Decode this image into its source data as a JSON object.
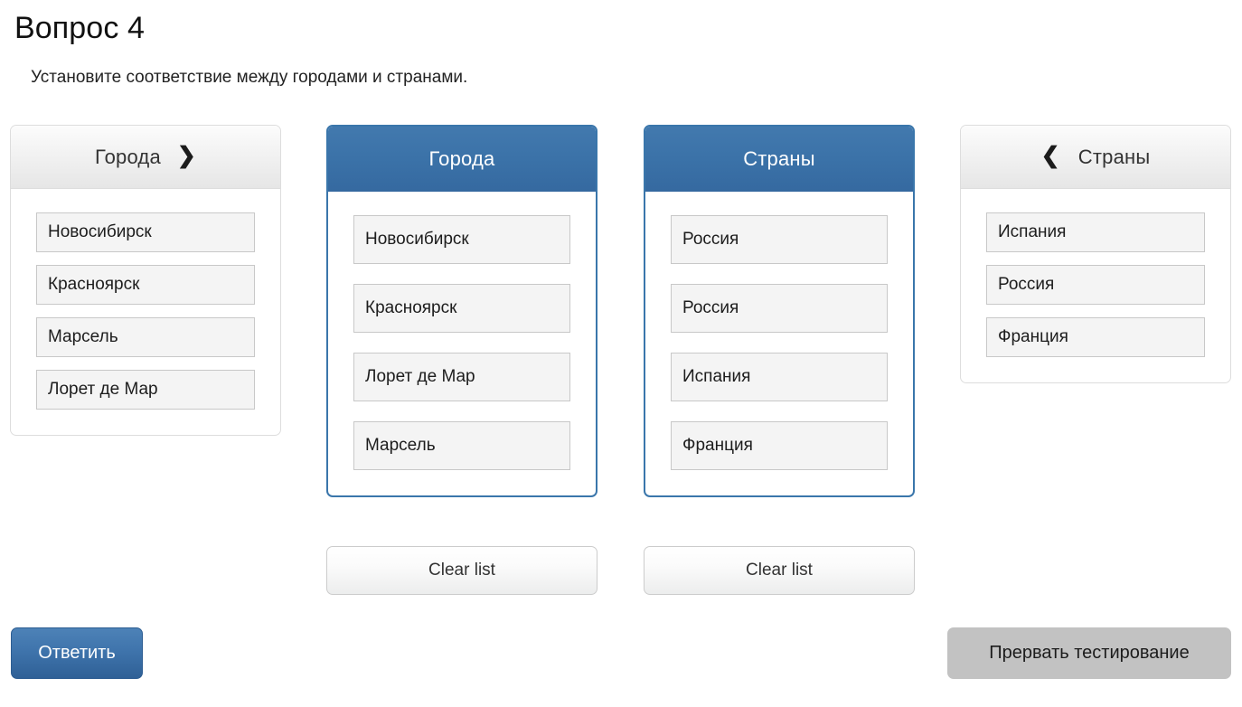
{
  "question": {
    "title": "Вопрос 4",
    "instruction": "Установите соответствие между городами и странами."
  },
  "colors": {
    "accent_blue": "#3a76ab",
    "button_blue": "#3f74ac",
    "abort_gray": "#c2c2c2",
    "item_fill": "#f4f4f4",
    "item_border": "#c8c8c8"
  },
  "panels": {
    "source_cities": {
      "header": "Города",
      "icon": "chevron-right-icon",
      "selected": false,
      "items": [
        "Новосибирск",
        "Красноярск",
        "Марсель",
        "Лорет де Мар"
      ]
    },
    "answer_cities": {
      "header": "Города",
      "selected": true,
      "items": [
        "Новосибирск",
        "Красноярск",
        "Лорет де Мар",
        "Марсель"
      ],
      "clear_label": "Clear list"
    },
    "answer_countries": {
      "header": "Страны",
      "selected": true,
      "items": [
        "Россия",
        "Россия",
        "Испания",
        "Франция"
      ],
      "clear_label": "Clear list"
    },
    "source_countries": {
      "header": "Страны",
      "icon": "chevron-left-icon",
      "selected": false,
      "items": [
        "Испания",
        "Россия",
        "Франция"
      ]
    }
  },
  "icons": {
    "chevron_right": "❯",
    "chevron_left": "❮"
  },
  "footer": {
    "submit_label": "Ответить",
    "abort_label": "Прервать тестирование"
  }
}
